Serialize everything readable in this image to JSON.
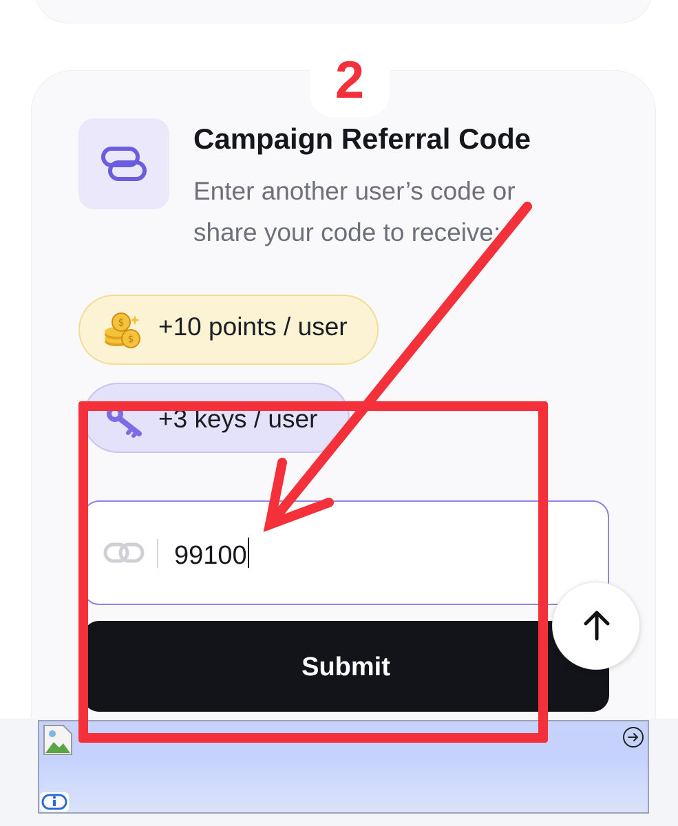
{
  "step": {
    "number": "2"
  },
  "referral": {
    "title": "Campaign Referral Code",
    "description": "Enter another user’s code or share your code to receive:"
  },
  "rewards": [
    {
      "label": "+10 points / user",
      "icon": "coins-icon",
      "color": "#fcf3d4"
    },
    {
      "label": "+3 keys / user",
      "icon": "key-icon",
      "color": "#e4e1fb"
    }
  ],
  "code_input": {
    "value": "99100",
    "icon": "link-icon"
  },
  "submit": {
    "label": "Submit"
  },
  "scroll_top": {
    "icon": "arrow-up-icon"
  },
  "annotation": {
    "color": "#f4313b"
  },
  "ad": {
    "info_icon": "info-icon",
    "next_icon": "arrow-right-circle-icon"
  }
}
